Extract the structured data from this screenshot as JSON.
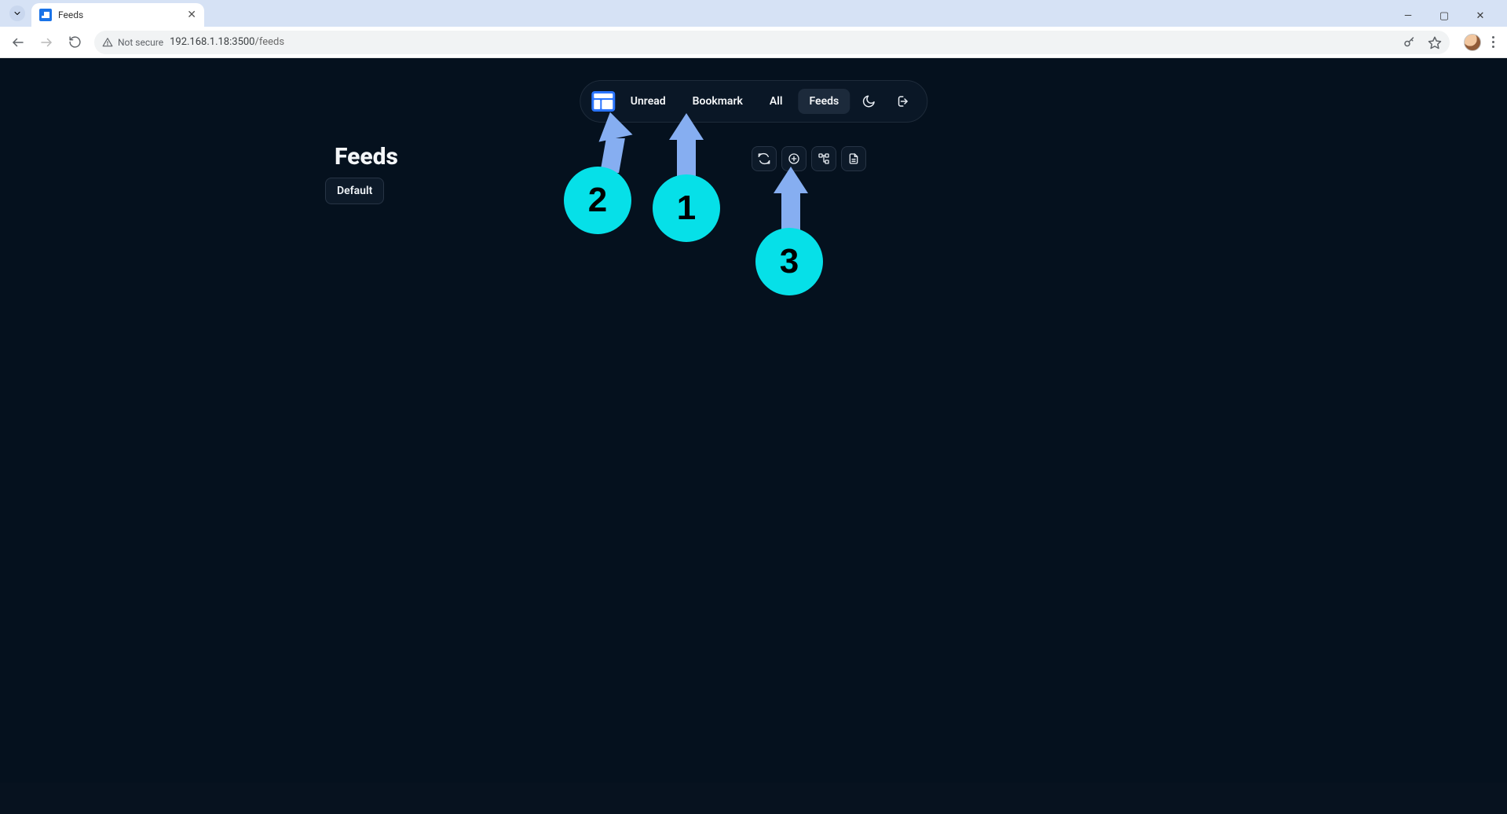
{
  "browser": {
    "tab_title": "Feeds",
    "security_label": "Not secure",
    "url_host": "192.168.1.18:3500",
    "url_path": "/feeds"
  },
  "nav": {
    "items": [
      {
        "label": "Unread",
        "active": false
      },
      {
        "label": "Bookmark",
        "active": false
      },
      {
        "label": "All",
        "active": false
      },
      {
        "label": "Feeds",
        "active": true
      }
    ]
  },
  "page": {
    "title": "Feeds",
    "default_category": "Default"
  },
  "actions": {
    "refresh": "Refresh feeds",
    "add": "Add feed",
    "categories": "Manage categories",
    "import": "Import OPML"
  },
  "annotations": {
    "a1": "1",
    "a2": "2",
    "a3": "3"
  }
}
